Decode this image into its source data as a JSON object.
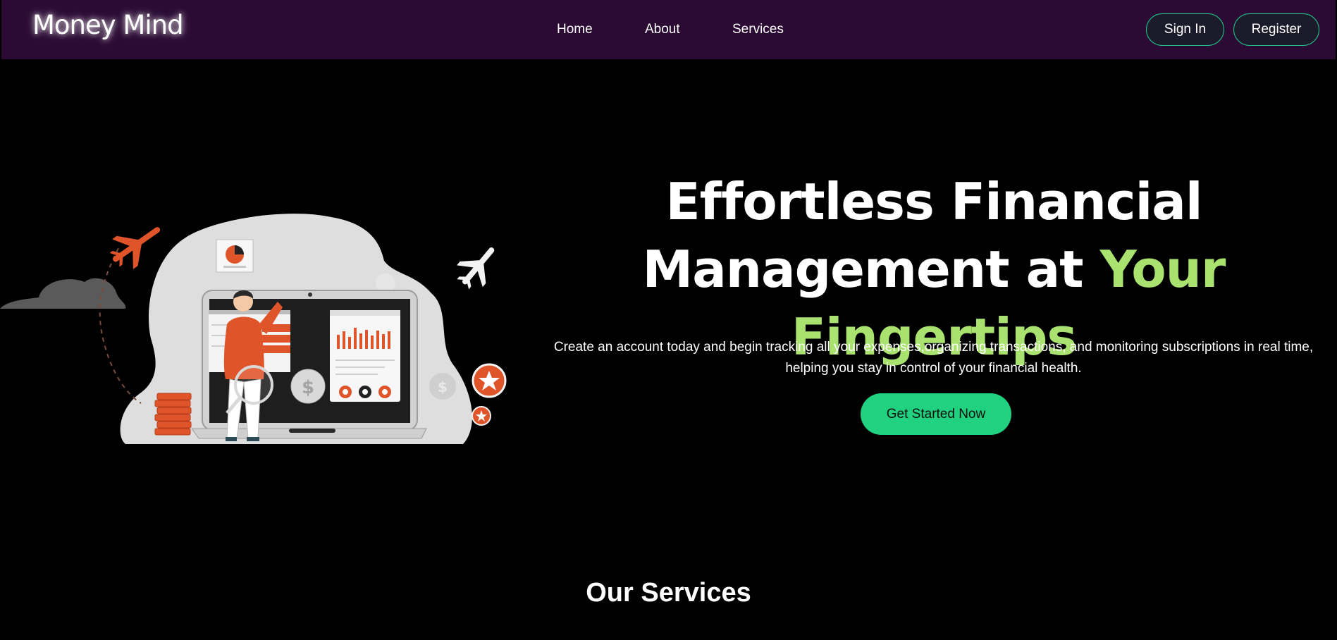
{
  "brand": {
    "name": "Money Mind"
  },
  "nav": {
    "links": [
      "Home",
      "About",
      "Services"
    ],
    "sign_in": "Sign In",
    "register": "Register"
  },
  "hero": {
    "title_line1": "Effortless Financial",
    "title_line2_prefix": "Management at ",
    "title_line2_accent": "Your Fingertips",
    "description_line1": "Create an account today and begin tracking all your expenses,organizing transactions, and monitoring subscriptions in real time,",
    "description_line2": "helping you stay in control of your financial health.",
    "cta": "Get Started Now",
    "illustration": {
      "icons": [
        "cloud-icon",
        "airplane-icon",
        "pie-chart-icon",
        "bar-chart-icon",
        "dollar-coin-icon",
        "star-badge-icon",
        "coin-stack-icon",
        "magnifier-icon",
        "laptop-icon",
        "person-figure"
      ]
    }
  },
  "services": {
    "title": "Our Services"
  },
  "colors": {
    "navbar_bg": "#2b0b33",
    "page_bg": "#000000",
    "accent_green": "#a9e26f",
    "cta_green": "#20d27f",
    "outline_teal": "#20c88a",
    "illustration_orange": "#e0542a"
  }
}
